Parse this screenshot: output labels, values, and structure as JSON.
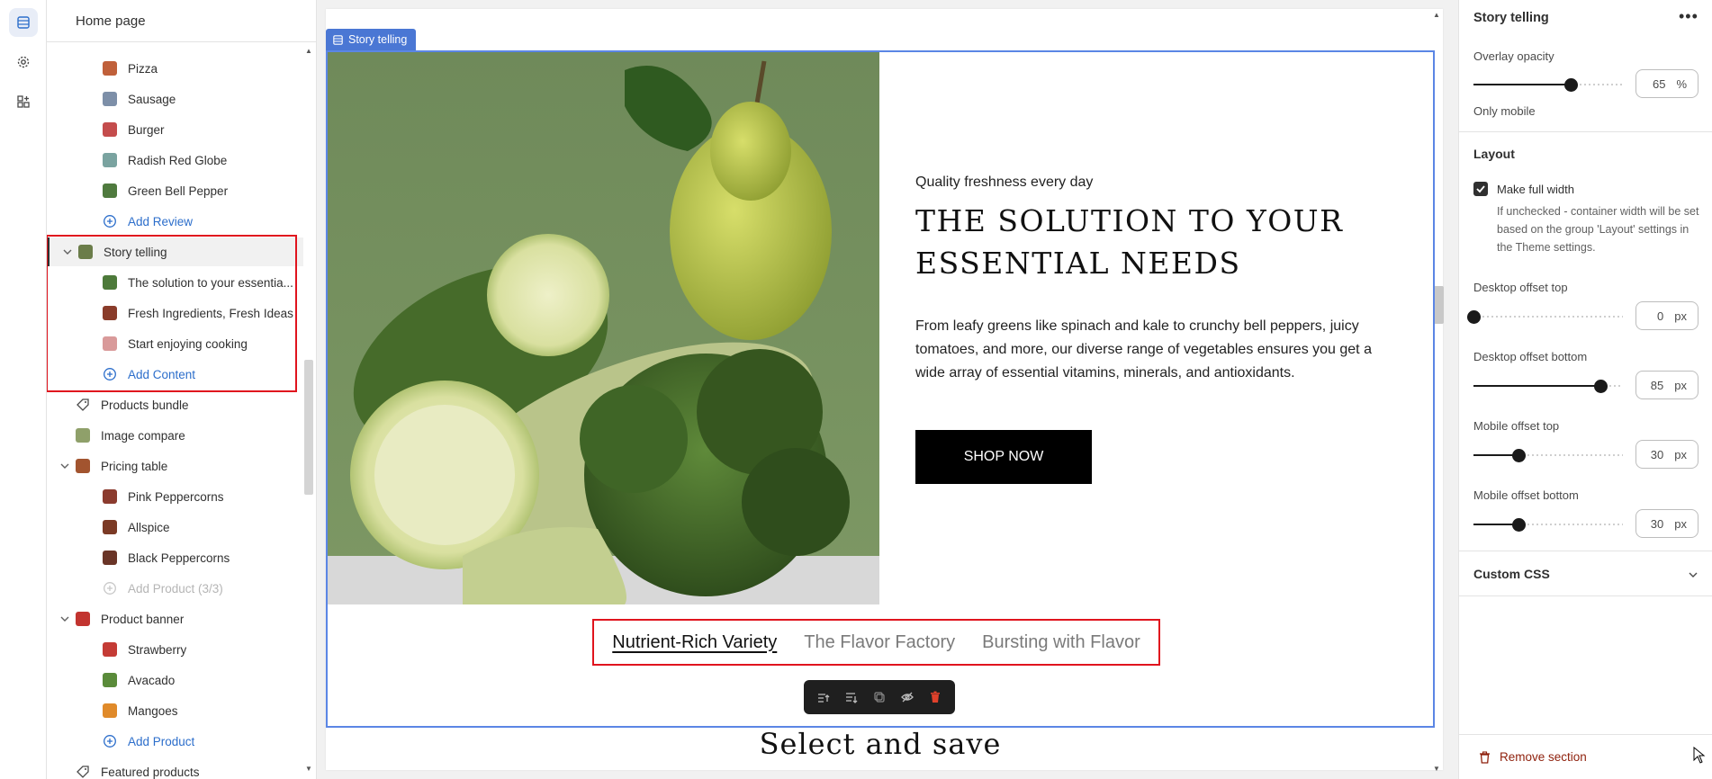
{
  "tree": {
    "header": "Home page",
    "items": [
      {
        "label": "Pizza",
        "kind": "child",
        "thumb": "#c0603a"
      },
      {
        "label": "Sausage",
        "kind": "child",
        "thumb": "#7d8fa8"
      },
      {
        "label": "Burger",
        "kind": "child",
        "thumb": "#c44c4c"
      },
      {
        "label": "Radish Red Globe",
        "kind": "child",
        "thumb": "#7aa3a0"
      },
      {
        "label": "Green Bell Pepper",
        "kind": "child",
        "thumb": "#4f7a3e"
      },
      {
        "label": "Add Review",
        "kind": "add"
      },
      {
        "label": "Story telling",
        "kind": "section-open-selected",
        "thumb": "#6b7d4a"
      },
      {
        "label": "The solution to your essentia...",
        "kind": "child",
        "thumb": "#4d7a3a"
      },
      {
        "label": "Fresh Ingredients, Fresh Ideas",
        "kind": "child",
        "thumb": "#8a3c2a"
      },
      {
        "label": "Start enjoying cooking",
        "kind": "child",
        "thumb": "#d99a9a"
      },
      {
        "label": "Add Content",
        "kind": "add"
      },
      {
        "label": "Products bundle",
        "kind": "section-tag"
      },
      {
        "label": "Image compare",
        "kind": "section-img",
        "thumb": "#8fa06a"
      },
      {
        "label": "Pricing table",
        "kind": "section-open",
        "thumb": "#a2542f"
      },
      {
        "label": "Pink Peppercorns",
        "kind": "child",
        "thumb": "#8b3b2e"
      },
      {
        "label": "Allspice",
        "kind": "child",
        "thumb": "#7b3a25"
      },
      {
        "label": "Black Peppercorns",
        "kind": "child",
        "thumb": "#6a3527"
      },
      {
        "label": "Add Product (3/3)",
        "kind": "add-disabled"
      },
      {
        "label": "Product banner",
        "kind": "section-open",
        "thumb": "#c2342f"
      },
      {
        "label": "Strawberry",
        "kind": "child",
        "thumb": "#c43b35"
      },
      {
        "label": "Avacado",
        "kind": "child",
        "thumb": "#5a8b3a"
      },
      {
        "label": "Mangoes",
        "kind": "child",
        "thumb": "#e08a2a"
      },
      {
        "label": "Add Product",
        "kind": "add"
      },
      {
        "label": "Featured products",
        "kind": "section-tag"
      }
    ]
  },
  "preview": {
    "section_tag": "Story telling",
    "eyebrow": "Quality freshness every day",
    "headline_line1": "THE SOLUTION TO YOUR",
    "headline_line2": "ESSENTIAL NEEDS",
    "body": "From leafy greens like spinach and kale to crunchy bell peppers, juicy tomatoes, and more, our diverse range of vegetables ensures you get a wide array of essential vitamins, minerals, and antioxidants.",
    "button": "SHOP NOW",
    "tabs": [
      "Nutrient-Rich Variety",
      "The Flavor Factory",
      "Bursting with Flavor"
    ],
    "next_section_title": "Select and save"
  },
  "settings": {
    "title": "Story telling",
    "more": "•••",
    "overlay_label": "Overlay opacity",
    "overlay_value": "65",
    "overlay_unit": "%",
    "overlay_level": 0.65,
    "only_mobile": "Only mobile",
    "layout_heading": "Layout",
    "full_width_label": "Make full width",
    "full_width_checked": true,
    "full_width_help": "If unchecked - container width will be set based on the group 'Layout' settings in the Theme settings.",
    "desktop_top_label": "Desktop offset top",
    "desktop_top_value": "0",
    "desktop_top_level": 0.0,
    "desktop_bottom_label": "Desktop offset bottom",
    "desktop_bottom_value": "85",
    "desktop_bottom_level": 0.85,
    "mobile_top_label": "Mobile offset top",
    "mobile_top_value": "30",
    "mobile_top_level": 0.3,
    "mobile_bottom_label": "Mobile offset bottom",
    "mobile_bottom_value": "30",
    "mobile_bottom_level": 0.3,
    "px_unit": "px",
    "custom_css": "Custom CSS",
    "remove": "Remove section"
  },
  "colors": {
    "accent": "#4a77d4",
    "highlight_red": "#e0141e",
    "link": "#2c6ecb",
    "danger": "#8e1f0b"
  }
}
